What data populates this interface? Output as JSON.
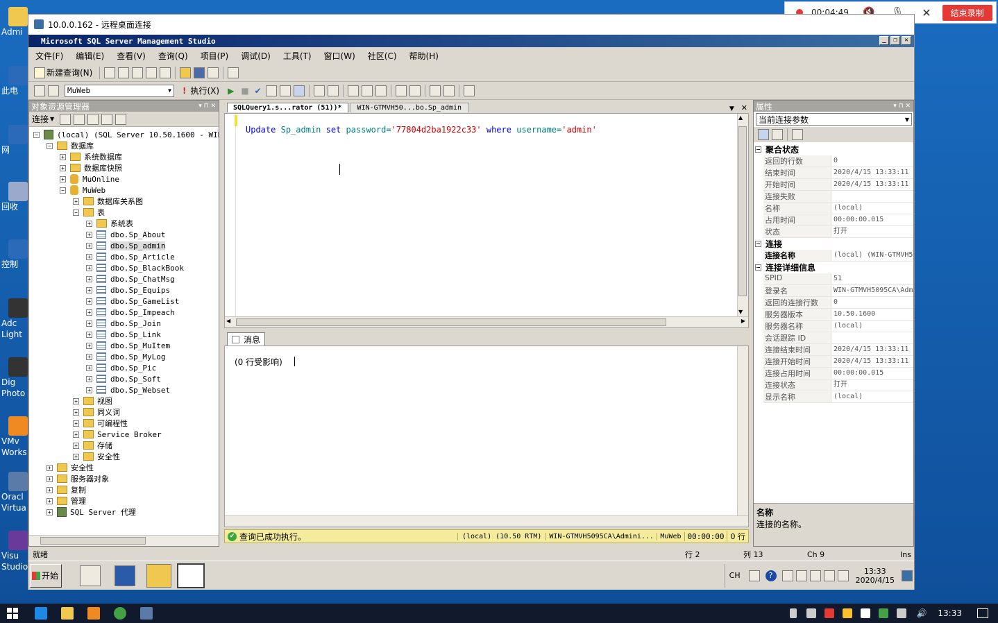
{
  "recorder": {
    "time": "00:04:49",
    "stop_label": "结束录制"
  },
  "desktop_icons": [
    "Admi",
    "此电",
    "网",
    "回收",
    "控制",
    "Adc Light",
    "Dig Photo",
    "VMv Works",
    "Oracl Virtua",
    "Visu Studio"
  ],
  "rdp": {
    "title": "10.0.0.162 - 远程桌面连接"
  },
  "ssms": {
    "title": "Microsoft SQL Server Management Studio",
    "menu": [
      "文件(F)",
      "编辑(E)",
      "查看(V)",
      "查询(Q)",
      "项目(P)",
      "调试(D)",
      "工具(T)",
      "窗口(W)",
      "社区(C)",
      "帮助(H)"
    ],
    "toolbar": {
      "new_query": "新建查询(N)",
      "database": "MuWeb",
      "execute": "执行(X)"
    },
    "object_explorer": {
      "title": "对象资源管理器",
      "connect": "连接",
      "nodes": [
        {
          "label": "(local) (SQL Server 10.50.1600 - WIN-G",
          "level": 0,
          "exp": "−",
          "icon": "srv"
        },
        {
          "label": "数据库",
          "level": 1,
          "exp": "−",
          "icon": "fold"
        },
        {
          "label": "系统数据库",
          "level": 2,
          "exp": "+",
          "icon": "fold"
        },
        {
          "label": "数据库快照",
          "level": 2,
          "exp": "+",
          "icon": "fold"
        },
        {
          "label": "MuOnline",
          "level": 2,
          "exp": "+",
          "icon": "db"
        },
        {
          "label": "MuWeb",
          "level": 2,
          "exp": "−",
          "icon": "db"
        },
        {
          "label": "数据库关系图",
          "level": 3,
          "exp": "+",
          "icon": "fold"
        },
        {
          "label": "表",
          "level": 3,
          "exp": "−",
          "icon": "fold"
        },
        {
          "label": "系统表",
          "level": 4,
          "exp": "+",
          "icon": "fold"
        },
        {
          "label": "dbo.Sp_About",
          "level": 4,
          "exp": "+",
          "icon": "tbl"
        },
        {
          "label": "dbo.Sp_admin",
          "level": 4,
          "exp": "+",
          "icon": "tbl",
          "selected": true
        },
        {
          "label": "dbo.Sp_Article",
          "level": 4,
          "exp": "+",
          "icon": "tbl"
        },
        {
          "label": "dbo.Sp_BlackBook",
          "level": 4,
          "exp": "+",
          "icon": "tbl"
        },
        {
          "label": "dbo.Sp_ChatMsg",
          "level": 4,
          "exp": "+",
          "icon": "tbl"
        },
        {
          "label": "dbo.Sp_Equips",
          "level": 4,
          "exp": "+",
          "icon": "tbl"
        },
        {
          "label": "dbo.Sp_GameList",
          "level": 4,
          "exp": "+",
          "icon": "tbl"
        },
        {
          "label": "dbo.Sp_Impeach",
          "level": 4,
          "exp": "+",
          "icon": "tbl"
        },
        {
          "label": "dbo.Sp_Join",
          "level": 4,
          "exp": "+",
          "icon": "tbl"
        },
        {
          "label": "dbo.Sp_Link",
          "level": 4,
          "exp": "+",
          "icon": "tbl"
        },
        {
          "label": "dbo.Sp_MuItem",
          "level": 4,
          "exp": "+",
          "icon": "tbl"
        },
        {
          "label": "dbo.Sp_MyLog",
          "level": 4,
          "exp": "+",
          "icon": "tbl"
        },
        {
          "label": "dbo.Sp_Pic",
          "level": 4,
          "exp": "+",
          "icon": "tbl"
        },
        {
          "label": "dbo.Sp_Soft",
          "level": 4,
          "exp": "+",
          "icon": "tbl"
        },
        {
          "label": "dbo.Sp_Webset",
          "level": 4,
          "exp": "+",
          "icon": "tbl"
        },
        {
          "label": "视图",
          "level": 3,
          "exp": "+",
          "icon": "fold"
        },
        {
          "label": "同义词",
          "level": 3,
          "exp": "+",
          "icon": "fold"
        },
        {
          "label": "可编程性",
          "level": 3,
          "exp": "+",
          "icon": "fold"
        },
        {
          "label": "Service Broker",
          "level": 3,
          "exp": "+",
          "icon": "fold"
        },
        {
          "label": "存储",
          "level": 3,
          "exp": "+",
          "icon": "fold"
        },
        {
          "label": "安全性",
          "level": 3,
          "exp": "+",
          "icon": "fold"
        },
        {
          "label": "安全性",
          "level": 1,
          "exp": "+",
          "icon": "fold"
        },
        {
          "label": "服务器对象",
          "level": 1,
          "exp": "+",
          "icon": "fold"
        },
        {
          "label": "复制",
          "level": 1,
          "exp": "+",
          "icon": "fold"
        },
        {
          "label": "管理",
          "level": 1,
          "exp": "+",
          "icon": "fold"
        },
        {
          "label": "SQL Server 代理",
          "level": 1,
          "exp": "+",
          "icon": "srv"
        }
      ]
    },
    "tabs": [
      "SQLQuery1.s...rator (51))*",
      "WIN-GTMVH50...bo.Sp_admin"
    ],
    "query": {
      "kw1": "Update",
      "table": "Sp_admin",
      "kw2": "set",
      "col1": "password=",
      "val1": "'77804d2ba1922c33'",
      "kw3": "where",
      "col2": "username=",
      "val2": "'admin'"
    },
    "messages": {
      "tab": "消息",
      "text": "(0 行受影响)"
    },
    "query_status": {
      "text": "查询已成功执行。",
      "server": "(local) (10.50 RTM)",
      "user": "WIN-GTMVH5095CA\\Admini...",
      "db": "MuWeb",
      "time": "00:00:00",
      "rows": "0 行"
    },
    "properties": {
      "title": "属性",
      "dropdown": "当前连接参数",
      "categories": [
        {
          "name": "聚合状态",
          "rows": [
            [
              "返回的行数",
              "0"
            ],
            [
              "结束时间",
              "2020/4/15 13:33:11"
            ],
            [
              "开始时间",
              "2020/4/15 13:33:11"
            ],
            [
              "连接失败",
              ""
            ],
            [
              "名称",
              "(local)"
            ],
            [
              "占用时间",
              "00:00:00.015"
            ],
            [
              "状态",
              "打开"
            ]
          ]
        },
        {
          "name": "连接",
          "rows": [
            [
              "连接名称",
              "(local) (WIN-GTMVH5"
            ]
          ],
          "bold_key": true
        },
        {
          "name": "连接详细信息",
          "rows": [
            [
              "SPID",
              "51"
            ],
            [
              "登录名",
              "WIN-GTMVH5095CA\\Adm"
            ],
            [
              "返回的连接行数",
              "0"
            ],
            [
              "服务器版本",
              "10.50.1600"
            ],
            [
              "服务器名称",
              "(local)"
            ],
            [
              "会话跟踪 ID",
              ""
            ],
            [
              "连接结束时间",
              "2020/4/15 13:33:11"
            ],
            [
              "连接开始时间",
              "2020/4/15 13:33:11"
            ],
            [
              "连接占用时间",
              "00:00:00.015"
            ],
            [
              "连接状态",
              "打开"
            ],
            [
              "显示名称",
              "(local)"
            ]
          ]
        }
      ],
      "desc_title": "名称",
      "desc_text": "连接的名称。"
    },
    "statusbar": {
      "ready": "就绪",
      "line": "行 2",
      "col": "列 13",
      "ch": "Ch 9",
      "mode": "Ins"
    },
    "inner_taskbar": {
      "start": "开始",
      "lang": "CH",
      "time": "13:33",
      "date": "2020/4/15"
    }
  },
  "host_taskbar": {
    "time": "13:33"
  }
}
